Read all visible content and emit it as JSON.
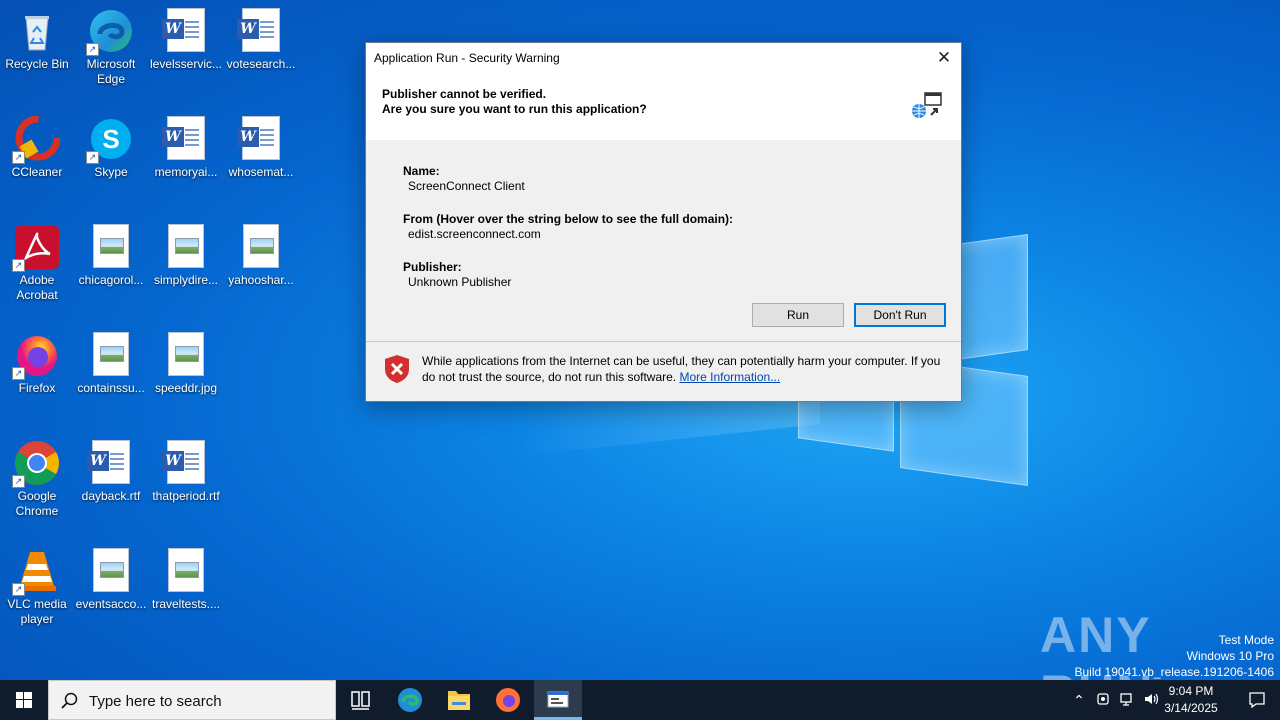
{
  "desktop": {
    "icons": [
      {
        "label": "Recycle Bin",
        "icon": "recycle-bin-icon"
      },
      {
        "label": "Microsoft Edge",
        "icon": "edge-icon"
      },
      {
        "label": "levelsservic...",
        "icon": "word-document-icon"
      },
      {
        "label": "votesearch...",
        "icon": "word-document-icon"
      },
      {
        "label": "CCleaner",
        "icon": "ccleaner-icon"
      },
      {
        "label": "Skype",
        "icon": "skype-icon"
      },
      {
        "label": "memoryai...",
        "icon": "word-document-icon"
      },
      {
        "label": "whosemat...",
        "icon": "word-document-icon"
      },
      {
        "label": "Adobe Acrobat",
        "icon": "acrobat-icon"
      },
      {
        "label": "chicagorol...",
        "icon": "image-file-icon"
      },
      {
        "label": "simplydire...",
        "icon": "image-file-icon"
      },
      {
        "label": "yahooshar...",
        "icon": "image-file-icon"
      },
      {
        "label": "Firefox",
        "icon": "firefox-icon"
      },
      {
        "label": "containssu...",
        "icon": "image-file-icon"
      },
      {
        "label": "speeddr.jpg",
        "icon": "image-file-icon"
      },
      {
        "label": "Google Chrome",
        "icon": "chrome-icon"
      },
      {
        "label": "dayback.rtf",
        "icon": "word-document-icon"
      },
      {
        "label": "thatperiod.rtf",
        "icon": "word-document-icon"
      },
      {
        "label": "VLC media player",
        "icon": "vlc-icon"
      },
      {
        "label": "eventsacco...",
        "icon": "image-file-icon"
      },
      {
        "label": "traveltests....",
        "icon": "image-file-icon"
      }
    ]
  },
  "dialog": {
    "title": "Application Run - Security Warning",
    "close_icon": "close-icon",
    "heading_line1": "Publisher cannot be verified.",
    "heading_line2": "Are you sure you want to run this application?",
    "name_label": "Name:",
    "name_value": "ScreenConnect Client",
    "from_label": "From (Hover over the string below to see the full domain):",
    "from_value": "edist.screenconnect.com",
    "publisher_label": "Publisher:",
    "publisher_value": "Unknown Publisher",
    "run_button": "Run",
    "dont_run_button": "Don't Run",
    "warning_text": "While applications from the Internet can be useful, they can potentially harm your computer. If you do not trust the source, do not run this software.",
    "more_info_link": "More Information...",
    "colors": {
      "accent": "#0078d7",
      "shield": "#d32f2f"
    }
  },
  "watermark": {
    "brand": "ANY RUN",
    "line1": "Test Mode",
    "line2": "Windows 10 Pro",
    "line3": "Build 19041.vb_release.191206-1406"
  },
  "taskbar": {
    "search_placeholder": "Type here to search",
    "time": "9:04 PM",
    "date": "3/14/2025",
    "apps": [
      "task-view-icon",
      "edge-icon",
      "file-explorer-icon",
      "firefox-icon",
      "application-run-icon"
    ]
  }
}
